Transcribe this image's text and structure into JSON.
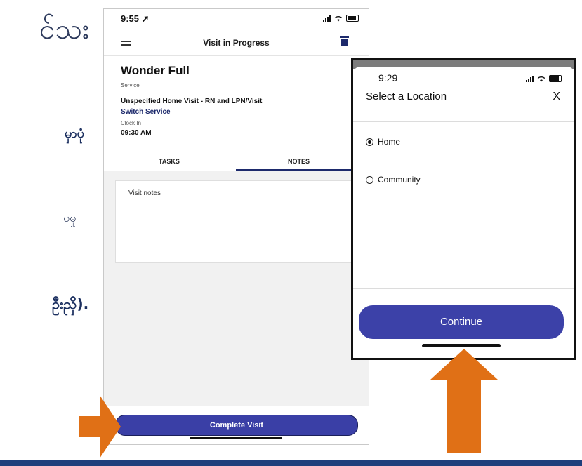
{
  "slide": {
    "text_1": "င်သး",
    "text_2": "မှာပုံ",
    "text_3": "ပမှု",
    "text_4": "ဦးညှိ)."
  },
  "phone_visit": {
    "status_time": "9:55 ➚",
    "header_title": "Visit in Progress",
    "client_name": "Wonder Full",
    "service_label": "Service",
    "service_value": "Unspecified Home Visit - RN and LPN/Visit",
    "switch_service": "Switch Service",
    "clock_in_label": "Clock In",
    "clock_in_value": "09:30 AM",
    "tabs": [
      "TASKS",
      "NOTES"
    ],
    "active_tab": "NOTES",
    "notes_placeholder": "Visit notes",
    "complete_button": "Complete Visit"
  },
  "phone_location": {
    "status_time": "9:29",
    "title": "Select a Location",
    "close": "X",
    "options": [
      {
        "label": "Home",
        "selected": true
      },
      {
        "label": "Community",
        "selected": false
      }
    ],
    "continue_button": "Continue"
  },
  "colors": {
    "button_blue": "#3a3fa6",
    "arrow_orange": "#e07016",
    "footer_navy": "#1f3f7c"
  }
}
